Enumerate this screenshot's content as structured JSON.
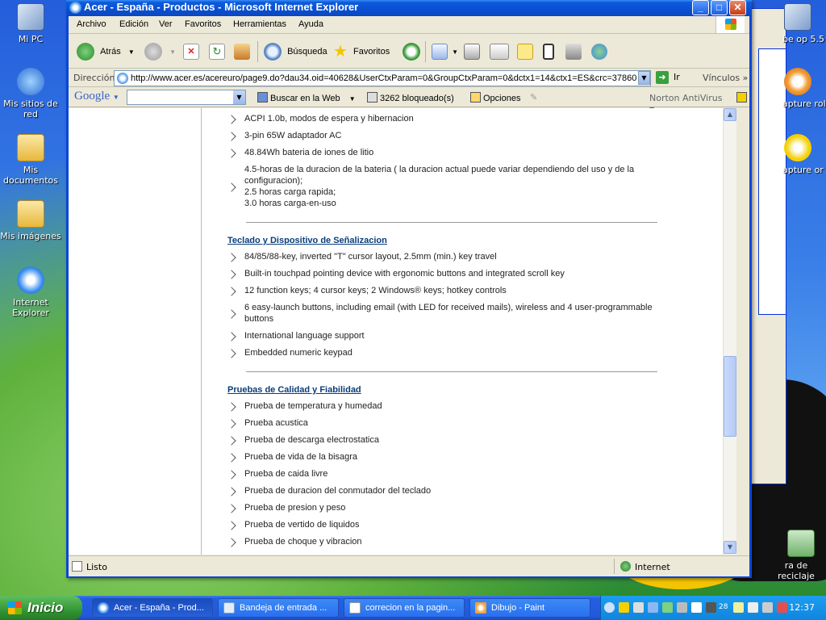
{
  "desktop": {
    "icons": [
      {
        "label": "Mi PC"
      },
      {
        "label": "Mis sitios de red"
      },
      {
        "label": "Mis documentos"
      },
      {
        "label": "Mis imágenes"
      },
      {
        "label": "Internet Explorer"
      }
    ],
    "right_icons": [
      {
        "label": "be op 5.5"
      },
      {
        "label": "apture rol"
      },
      {
        "label": "apture or"
      },
      {
        "label": "ra de reciclaje"
      }
    ]
  },
  "window": {
    "title": "Acer - España - Productos - Microsoft Internet Explorer",
    "menu": [
      "Archivo",
      "Edición",
      "Ver",
      "Favoritos",
      "Herramientas",
      "Ayuda"
    ],
    "toolbar": {
      "back": "Atrás",
      "search": "Búsqueda",
      "favorites": "Favoritos"
    },
    "address": {
      "label": "Dirección",
      "url": "http://www.acer.es/acereuro/page9.do?dau34.oid=40628&UserCtxParam=0&GroupCtxParam=0&dctx1=14&ctx1=ES&crc=37860",
      "go": "Ir",
      "links": "Vínculos"
    },
    "google_bar": {
      "logo": "Google",
      "search_web": "Buscar en la Web",
      "blocked": "3262 bloqueado(s)",
      "options": "Opciones",
      "norton": "Norton AntiVirus"
    },
    "status": {
      "text": "Listo",
      "zone": "Internet"
    }
  },
  "page": {
    "battery_items": [
      "ACPI 1.0b, modos de espera y hibernacion",
      "3-pin 65W adaptador AC",
      "48.84Wh bateria de iones de litio",
      "4.5-horas de la duracion de la bateria ( la duracion actual puede variar dependiendo del uso y de la configuracion);",
      "2.5 horas carga rapida;",
      "3.0 horas carga-en-uso"
    ],
    "keyboard": {
      "heading": "Teclado y Dispositivo de Señalizacion",
      "items": [
        "84/85/88-key, inverted \"T\" cursor layout, 2.5mm (min.) key travel",
        "Built-in touchpad pointing device with ergonomic buttons and integrated scroll key",
        "12 function keys; 4 cursor keys; 2 Windows® keys; hotkey controls",
        "6 easy-launch buttons, including email (with LED for received mails), wireless and 4 user-programmable buttons",
        "International language support",
        "Embedded numeric keypad"
      ]
    },
    "quality": {
      "heading": "Pruebas de Calidad y Fiabilidad",
      "items": [
        "Prueba de temperatura y humedad",
        "Prueba acustica",
        "Prueba de descarga electrostatica",
        "Prueba de vida de la bisagra",
        "Prueba de caida livre",
        "Prueba de duracion del conmutador del teclado",
        "Prueba de presion y peso",
        "Prueba de vertido de liquidos",
        "Prueba de choque y vibracion"
      ]
    }
  },
  "taskbar": {
    "start": "Inicio",
    "tasks": [
      "Acer - España - Prod...",
      "Bandeja de entrada ...",
      "correcion en la pagin...",
      "Dibujo - Paint"
    ],
    "tray_badge": "28",
    "clock": "12:37"
  },
  "colors": {
    "title_bar": "#0b4fd0",
    "section_heading": "#0a3d7a",
    "taskbar": "#245ee0",
    "start_button": "#2f8f2f"
  }
}
